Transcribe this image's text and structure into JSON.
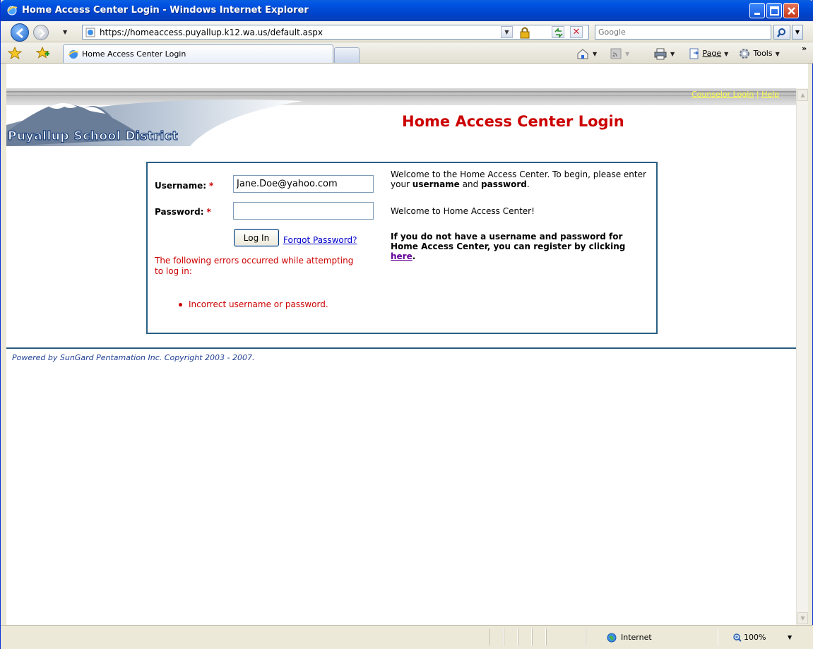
{
  "window": {
    "title": "Home Access Center Login - Windows Internet Explorer"
  },
  "addressbar": {
    "url": "https://homeaccess.puyallup.k12.wa.us/default.aspx",
    "search_placeholder": "Google"
  },
  "tabs": [
    {
      "label": "Home Access Center Login",
      "active": true
    }
  ],
  "commandbar": {
    "page_label": "Page",
    "tools_label": "Tools"
  },
  "header": {
    "links": [
      "Counselor Login",
      "Help"
    ],
    "link_separator": "|",
    "district_name": "Puyallup School District",
    "page_title": "Home Access Center Login"
  },
  "login": {
    "username_label": "Username:",
    "password_label": "Password:",
    "required_mark": "*",
    "username_value": "Jane.Doe@yahoo.com",
    "password_value": "",
    "login_button": "Log In",
    "forgot_password": "Forgot Password?",
    "error_intro": "The following errors occurred while attempting to log in:",
    "errors": [
      "Incorrect username or password."
    ]
  },
  "info": {
    "welcome_text_pre": "Welcome to the Home Access Center. To begin, please enter your ",
    "welcome_bold1": "username",
    "welcome_and": " and ",
    "welcome_bold2": "password",
    "welcome_end": ".",
    "welcome_message": "Welcome to Home Access Center!",
    "register_text": "If you do not have a username and password for Home Access Center, you can register by clicking ",
    "register_link": "here",
    "register_end": "."
  },
  "footer": {
    "text": "Powered by SunGard Pentamation Inc. Copyright 2003 - 2007."
  },
  "statusbar": {
    "zone": "Internet",
    "zoom": "100%"
  },
  "colors": {
    "title_red": "#cc0000",
    "panel_border": "#2a6084",
    "link_blue": "#0000cc",
    "visited_purple": "#660099",
    "header_link_yellow": "#ffff4d"
  }
}
